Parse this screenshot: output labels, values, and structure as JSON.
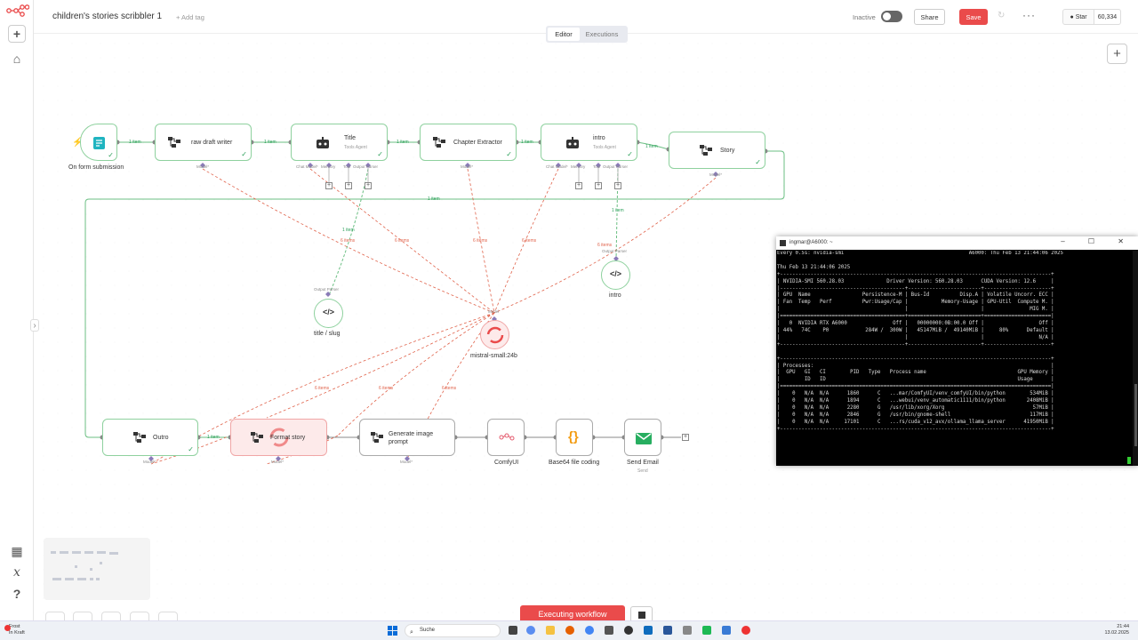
{
  "app": {
    "logo": "n8n-logo"
  },
  "header": {
    "workflow_title": "children's stories scribbler 1",
    "add_tag": "+ Add tag",
    "inactive_label": "Inactive",
    "share_label": "Share",
    "save_label": "Save",
    "more_label": "···",
    "github_star": "Star",
    "github_count": "60,334"
  },
  "tabs": {
    "editor": "Editor",
    "executions": "Executions"
  },
  "sidebar": {
    "plus": "+",
    "home": "⌂",
    "item_b1": "▦",
    "item_b2": "x",
    "item_b3": "?"
  },
  "nodes": {
    "trigger": {
      "label": "On form submission",
      "icon": "form-icon"
    },
    "raw_draft": {
      "label": "raw draft writer",
      "port": "Model*"
    },
    "title": {
      "label": "Title",
      "sub": "Tools Agent",
      "port1": "Chat Model*",
      "port2": "Memory",
      "port3": "Tool",
      "port4": "Output Parser"
    },
    "chapter": {
      "label": "Chapter Extractor",
      "port": "Model*"
    },
    "intro_agent": {
      "label": "intro",
      "sub": "Tools Agent",
      "port1": "Chat Model*",
      "port2": "Memory",
      "port3": "Tool",
      "port4": "Output Parser"
    },
    "story": {
      "label": "Story",
      "port": "Model*"
    },
    "title_slug": {
      "label": "title / slug",
      "port": "Output Parser"
    },
    "intro_parser": {
      "label": "intro",
      "port": "Output Parser"
    },
    "mistral": {
      "label": "mistral-small:24b",
      "port": "Model"
    },
    "outro": {
      "label": "Outro",
      "port": "Model*"
    },
    "format_story": {
      "label": "Format story",
      "port": "Model*"
    },
    "gen_image": {
      "label": "Generate image prompt",
      "port": "Model*"
    },
    "comfyui": {
      "label": "ComfyUI"
    },
    "base64": {
      "label": "Base64 file coding",
      "icon_text": "{}"
    },
    "send_email": {
      "label": "Send Email",
      "sub": "Send"
    }
  },
  "edges": {
    "one_item": "1 item",
    "six_items": "6 items"
  },
  "footer": {
    "execute_label": "Executing workflow"
  },
  "terminal": {
    "title": "ingmar@A6000: ~",
    "controls": "–  ☐  ✕",
    "lines": [
      "Every 0.5s: nvidia-smi                                         A6000: Thu Feb 13 21:44:06 2025",
      "",
      "Thu Feb 13 21:44:06 2025",
      "+-----------------------------------------------------------------------------------------+",
      "| NVIDIA-SMI 560.28.03              Driver Version: 560.28.03      CUDA Version: 12.6     |",
      "|-----------------------------------------+------------------------+----------------------+",
      "| GPU  Name                 Persistence-M | Bus-Id          Disp.A | Volatile Uncorr. ECC |",
      "| Fan  Temp   Perf          Pwr:Usage/Cap |           Memory-Usage | GPU-Util  Compute M. |",
      "|                                         |                        |               MIG M. |",
      "|=========================================+========================+======================|",
      "|   0  NVIDIA RTX A6000               Off |   00000000:0B:00.0 Off |                  Off |",
      "| 44%   74C    P0            284W /  300W |   45147MiB /  49140MiB |     80%      Default |",
      "|                                         |                        |                  N/A |",
      "+-----------------------------------------+------------------------+----------------------+",
      "",
      "+-----------------------------------------------------------------------------------------+",
      "| Processes:                                                                              |",
      "|  GPU   GI   CI        PID   Type   Process name                              GPU Memory |",
      "|        ID   ID                                                               Usage      |",
      "|=========================================================================================|",
      "|    0   N/A  N/A      1860      C   ...mar/ComfyUI/venv_comfyUI/bin/python        534MiB |",
      "|    0   N/A  N/A      1894      C   ...webui/venv_automatic1111/bin/python       2408MiB |",
      "|    0   N/A  N/A      2280      G   /usr/lib/xorg/Xorg                             57MiB |",
      "|    0   N/A  N/A      2846      G   /usr/bin/gnome-shell                          117MiB |",
      "|    0   N/A  N/A     17101      C   ...rs/cuda_v12_avx/ollama_llama_server      41950MiB |",
      "+-----------------------------------------------------------------------------------------+"
    ]
  },
  "taskbar": {
    "weather_line1": "Frost",
    "weather_line2": "In Kraft",
    "search_placeholder": "Suche",
    "time": "21:44",
    "date": "13.02.2025"
  },
  "colors": {
    "accent": "#ea4b4b",
    "success": "#2ba05a",
    "model_edge": "#e0624a",
    "node_border": "#8ed19e"
  }
}
